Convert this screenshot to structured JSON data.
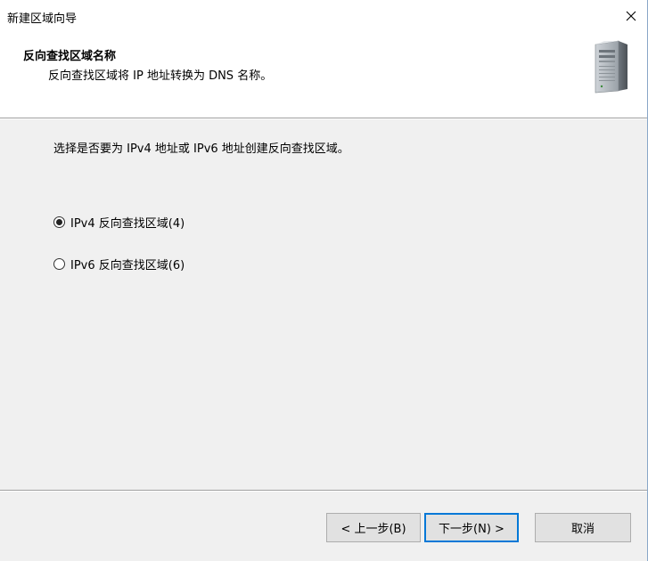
{
  "window": {
    "title": "新建区域向导",
    "close_label": "✕"
  },
  "header": {
    "title": "反向查找区域名称",
    "subtitle": "反向查找区域将 IP 地址转换为 DNS 名称。",
    "icon": "server-icon"
  },
  "body": {
    "prompt": "选择是否要为 IPv4 地址或 IPv6 地址创建反向查找区域。",
    "options": [
      {
        "label": "IPv4 反向查找区域(4)",
        "selected": true
      },
      {
        "label": "IPv6 反向查找区域(6)",
        "selected": false
      }
    ]
  },
  "buttons": {
    "back": "< 上一步(B)",
    "next": "下一步(N) >",
    "cancel": "取消"
  },
  "colors": {
    "accent": "#0078d7",
    "dialog_bg": "#f0f0f0",
    "header_bg": "#ffffff"
  }
}
